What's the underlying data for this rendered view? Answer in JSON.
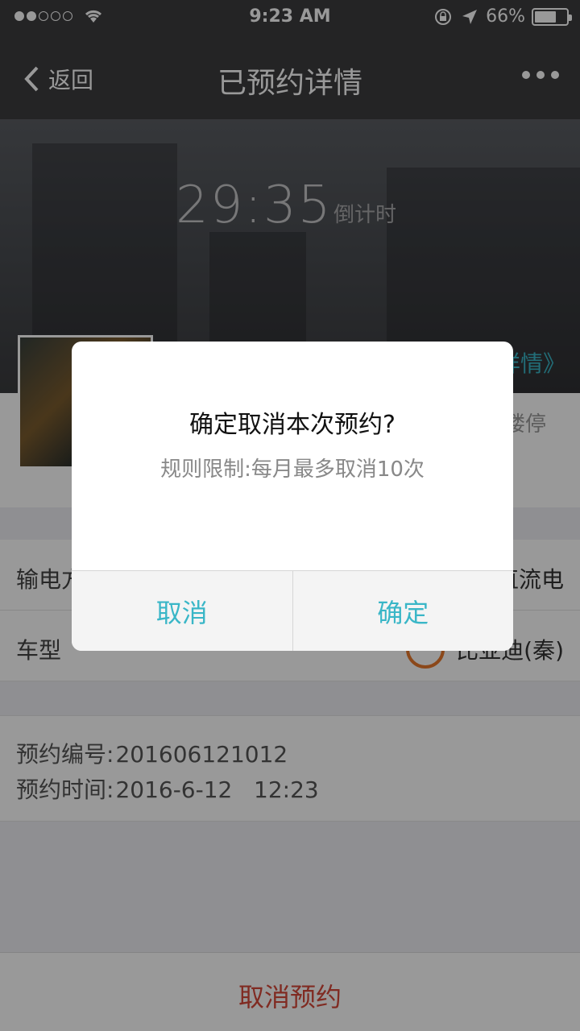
{
  "status_bar": {
    "time": "9:23 AM",
    "battery_percent": "66%",
    "signal_bars_filled": 2,
    "signal_bars_total": 5
  },
  "nav": {
    "back_label": "返回",
    "title": "已预约详情"
  },
  "hero": {
    "countdown": "29:35",
    "countdown_label": "倒计时",
    "detail_link": "详情》"
  },
  "info": {
    "partial_text": "楼停"
  },
  "rows": [
    {
      "label": "输电方",
      "value": "直流电"
    },
    {
      "label": "车型",
      "value": "比亚迪(秦)"
    }
  ],
  "meta": {
    "order_label": "预约编号:",
    "order_value": "201606121012",
    "time_label": "预约时间:",
    "time_value": "2016-6-12   12:23"
  },
  "bottom": {
    "cancel_booking": "取消预约"
  },
  "dialog": {
    "title": "确定取消本次预约?",
    "message": "规则限制:每月最多取消10次",
    "cancel_label": "取消",
    "confirm_label": "确定"
  },
  "colors": {
    "accent": "#39b6c7",
    "danger": "#d6483a",
    "nav_bg": "#3c3c3f"
  }
}
